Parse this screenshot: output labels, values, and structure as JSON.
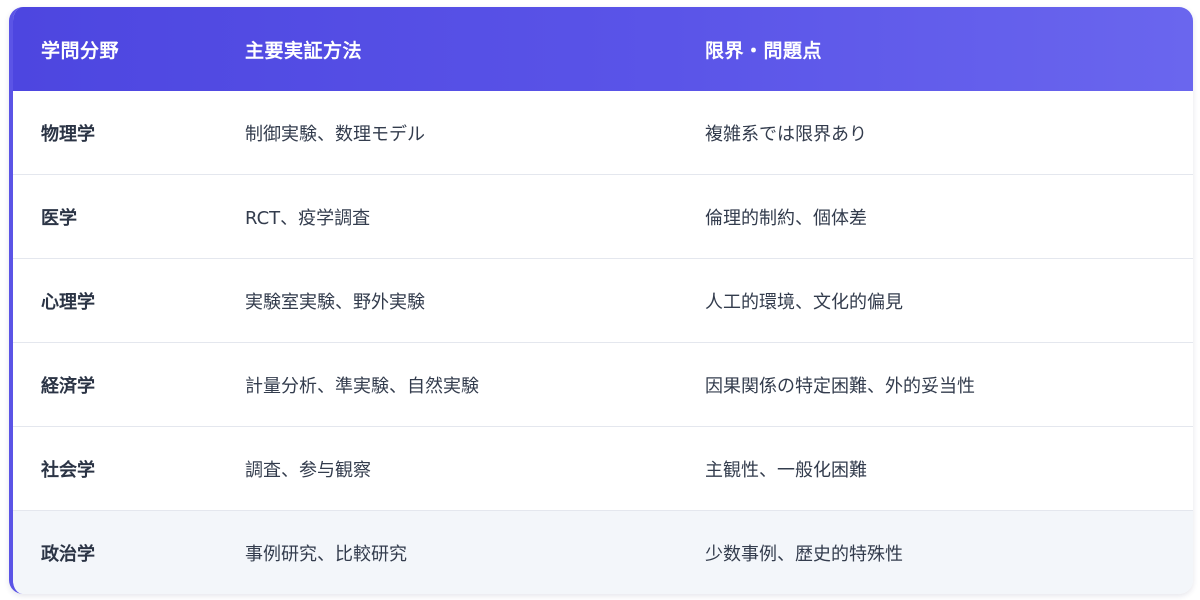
{
  "table": {
    "headers": [
      "学問分野",
      "主要実証方法",
      "限界・問題点"
    ],
    "rows": [
      [
        "物理学",
        "制御実験、数理モデル",
        "複雑系では限界あり"
      ],
      [
        "医学",
        "RCT、疫学調査",
        "倫理的制約、個体差"
      ],
      [
        "心理学",
        "実験室実験、野外実験",
        "人工的環境、文化的偏見"
      ],
      [
        "経済学",
        "計量分析、準実験、自然実験",
        "因果関係の特定困難、外的妥当性"
      ],
      [
        "社会学",
        "調査、参与観察",
        "主観性、一般化困難"
      ],
      [
        "政治学",
        "事例研究、比較研究",
        "少数事例、歴史的特殊性"
      ]
    ]
  },
  "colors": {
    "header_start": "#4d46e0",
    "header_end": "#6a66ee",
    "accent_border": "#5b54e6",
    "highlight_row": "#f3f6fa"
  }
}
